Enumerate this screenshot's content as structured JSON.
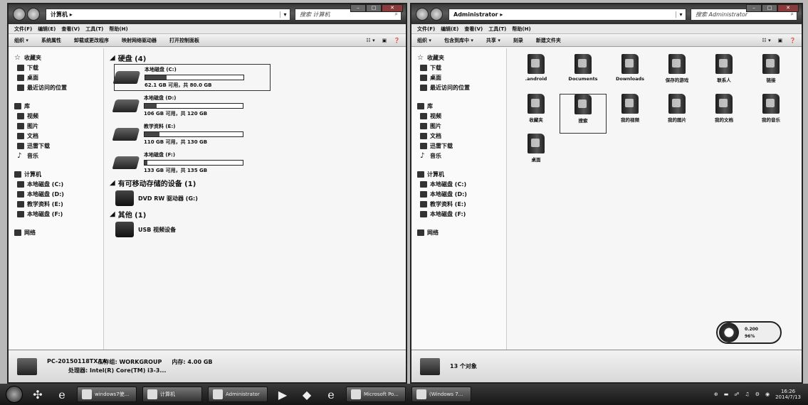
{
  "left_window": {
    "address": "计算机 ▸",
    "search_placeholder": "搜索 计算机",
    "menu": [
      "文件(F)",
      "编辑(E)",
      "查看(V)",
      "工具(T)",
      "帮助(H)"
    ],
    "toolbar": [
      "组织 ▾",
      "系统属性",
      "卸载或更改程序",
      "映射网络驱动器",
      "打开控制面板"
    ],
    "nav": {
      "favorites": "收藏夹",
      "fav_items": [
        "下载",
        "桌面",
        "最近访问的位置"
      ],
      "libraries": "库",
      "lib_items": [
        "视频",
        "图片",
        "文档",
        "迅雷下载",
        "音乐"
      ],
      "computer": "计算机",
      "comp_items": [
        "本地磁盘 (C:)",
        "本地磁盘 (D:)",
        "教学资料 (E:)",
        "本地磁盘 (F:)"
      ],
      "network": "网络"
    },
    "groups": {
      "hdd": "硬盘 (4)",
      "removable": "有可移动存储的设备 (1)",
      "other": "其他 (1)"
    },
    "drives": [
      {
        "name": "本地磁盘 (C:)",
        "free": "62.1 GB 可用，共 80.0 GB",
        "used_fraction": 0.22
      },
      {
        "name": "本地磁盘 (D:)",
        "free": "106 GB 可用，共 120 GB",
        "used_fraction": 0.12
      },
      {
        "name": "教学资料 (E:)",
        "free": "110 GB 可用，共 130 GB",
        "used_fraction": 0.15
      },
      {
        "name": "本地磁盘 (F:)",
        "free": "133 GB 可用，共 135 GB",
        "used_fraction": 0.03
      }
    ],
    "dvd": "DVD RW 驱动器 (G:)",
    "usb": "USB 视频设备",
    "details": {
      "pc_name": "PC-20150118TXAA",
      "workgroup": "工作组: WORKGROUP",
      "memory": "内存: 4.00 GB",
      "processor": "处理器: Intel(R) Core(TM) i3-3..."
    }
  },
  "right_window": {
    "address": "Administrator ▸",
    "search_placeholder": "搜索 Administrator",
    "menu": [
      "文件(F)",
      "编辑(E)",
      "查看(V)",
      "工具(T)",
      "帮助(H)"
    ],
    "toolbar": [
      "组织 ▾",
      "包含到库中 ▾",
      "共享 ▾",
      "刻录",
      "新建文件夹"
    ],
    "nav": {
      "favorites": "收藏夹",
      "fav_items": [
        "下载",
        "桌面",
        "最近访问的位置"
      ],
      "libraries": "库",
      "lib_items": [
        "视频",
        "图片",
        "文档",
        "迅雷下载",
        "音乐"
      ],
      "computer": "计算机",
      "comp_items": [
        "本地磁盘 (C:)",
        "本地磁盘 (D:)",
        "教学资料 (E:)",
        "本地磁盘 (F:)"
      ],
      "network": "网络"
    },
    "folders": [
      ".android",
      "Documents",
      "Downloads",
      "保存的游戏",
      "联系人",
      "链接",
      "收藏夹",
      "搜索",
      "我的视频",
      "我的图片",
      "我的文档",
      "我的音乐",
      "桌面"
    ],
    "status": "13 个对象",
    "gadget": {
      "center": "CPU",
      "v1": "0.200",
      "v2": "96%"
    }
  },
  "taskbar": {
    "buttons": [
      "windows7使...",
      "计算机",
      "Administrator",
      "Microsoft Po...",
      "(Windows 7..."
    ],
    "time": "16:26",
    "date": "2014/7/13"
  }
}
